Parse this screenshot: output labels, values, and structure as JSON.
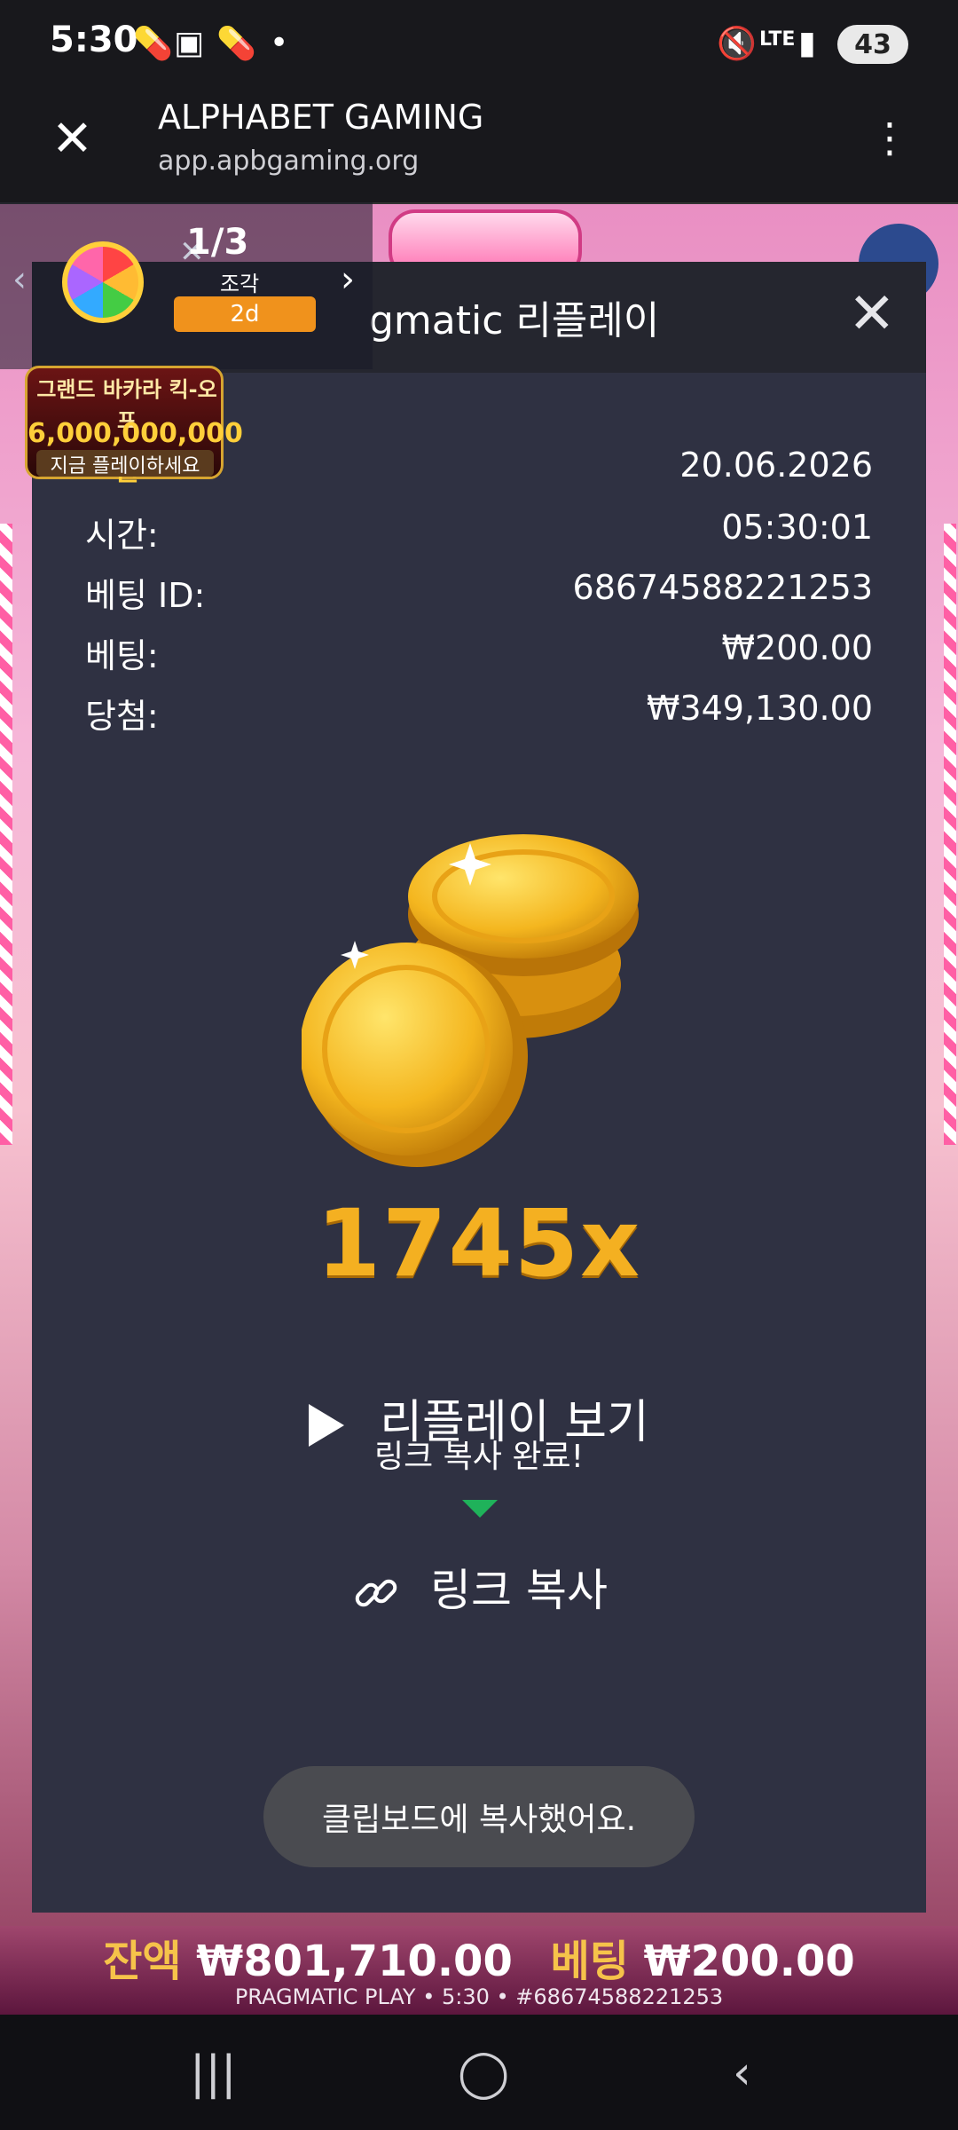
{
  "status_bar": {
    "time": "5:30",
    "battery": "43",
    "network": "LTE"
  },
  "browser": {
    "title": "ALPHABET GAMING",
    "url": "app.apbgaming.org"
  },
  "promo_badge": {
    "fraction": "1/3",
    "piece_label": "조각",
    "days": "2d",
    "promo_line1": "그랜드 바카라 킥-오프",
    "promo_amount": "6,000,000,000원",
    "promo_cta": "지금 플레이하세요"
  },
  "modal": {
    "title": "gmatic 리플레이",
    "rows": [
      {
        "label": "",
        "value": "20.06.2026"
      },
      {
        "label": "시간:",
        "value": "05:30:01"
      },
      {
        "label": "베팅 ID:",
        "value": "68674588221253"
      },
      {
        "label": "베팅:",
        "value": "₩200.00"
      },
      {
        "label": "당첨:",
        "value": "₩349,130.00"
      }
    ],
    "multiplier": "1745x",
    "replay_label": "리플레이 보기",
    "copied_tooltip": "링크 복사 완료!",
    "copy_link_label": "링크 복사",
    "toast": "클립보드에 복사했어요."
  },
  "footer": {
    "balance_label": "잔액",
    "balance_value": "₩801,710.00",
    "bet_label": "베팅",
    "bet_value": "₩200.00",
    "game_info": "PRAGMATIC PLAY • 5:30 • #68674588221253"
  },
  "icons": {
    "close": "close-icon",
    "menu": "more-vert-icon",
    "link": "link-icon",
    "play": "play-icon"
  },
  "colors": {
    "modal_bg": "#2f3142",
    "multiplier": "#f4b021",
    "accent_arrow": "#1fb25a",
    "days_badge": "#f0921c"
  }
}
